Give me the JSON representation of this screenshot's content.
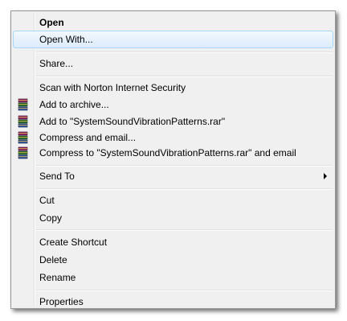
{
  "menu": {
    "open": "Open",
    "open_with": "Open With...",
    "share": "Share...",
    "scan": "Scan with Norton Internet Security",
    "add_to_archive": "Add to archive...",
    "add_to_rar": "Add to \"SystemSoundVibrationPatterns.rar\"",
    "compress_email": "Compress and email...",
    "compress_to_rar_email": "Compress to \"SystemSoundVibrationPatterns.rar\" and email",
    "send_to": "Send To",
    "cut": "Cut",
    "copy": "Copy",
    "create_shortcut": "Create Shortcut",
    "delete": "Delete",
    "rename": "Rename",
    "properties": "Properties"
  },
  "icons": {
    "archive": "winrar-books-icon",
    "submenu": "chevron-right-icon"
  },
  "colors": {
    "menu_bg": "#f0f0f0",
    "hover_border": "#a8d8f5",
    "hover_bg": "#dcebfc"
  }
}
